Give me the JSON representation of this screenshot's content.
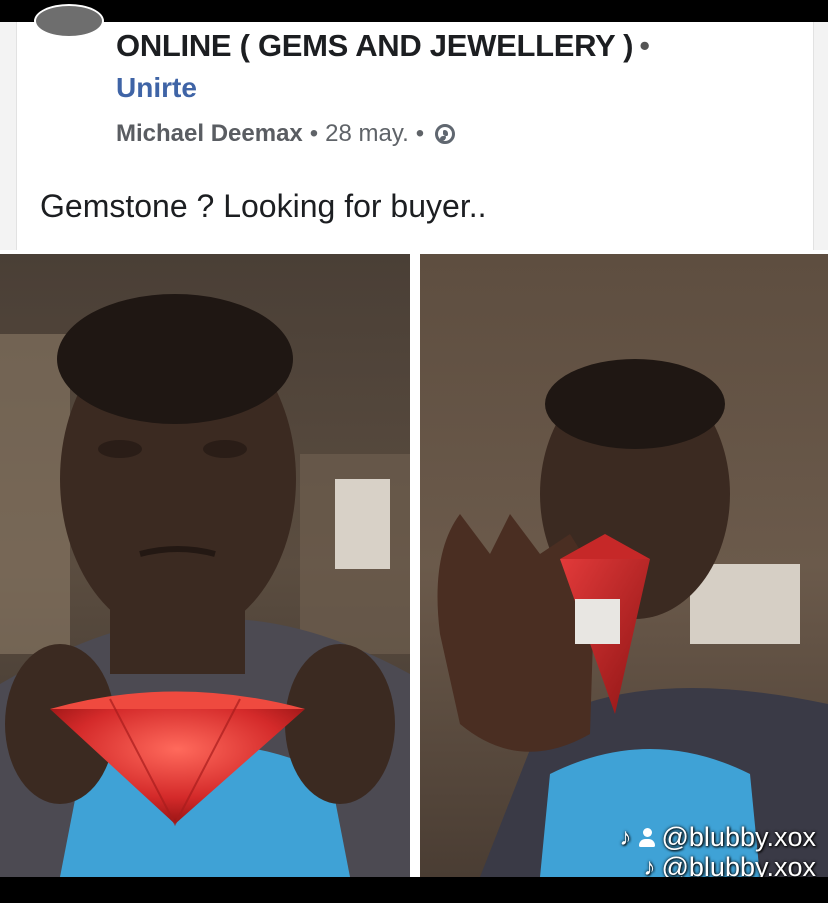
{
  "post": {
    "group_name": "ONLINE ( GEMS AND JEWELLERY )",
    "group_dot": "•",
    "join_label": "Unirte",
    "author": "Michael Deemax",
    "separator": "•",
    "date": "28 may.",
    "privacy_icon": "globe-icon",
    "text": "Gemstone ? Looking for buyer.."
  },
  "photos": [
    {
      "subject": "man-holding-red-gem-left"
    },
    {
      "subject": "man-holding-red-gem-right"
    }
  ],
  "watermark": {
    "handle": "@blubby.xox",
    "icons": [
      "tiktok-icon",
      "person-icon"
    ]
  },
  "colors": {
    "link": "#3f64a6",
    "text": "#1c1e21",
    "meta": "#5f6368",
    "gem": "#d42a2a"
  }
}
